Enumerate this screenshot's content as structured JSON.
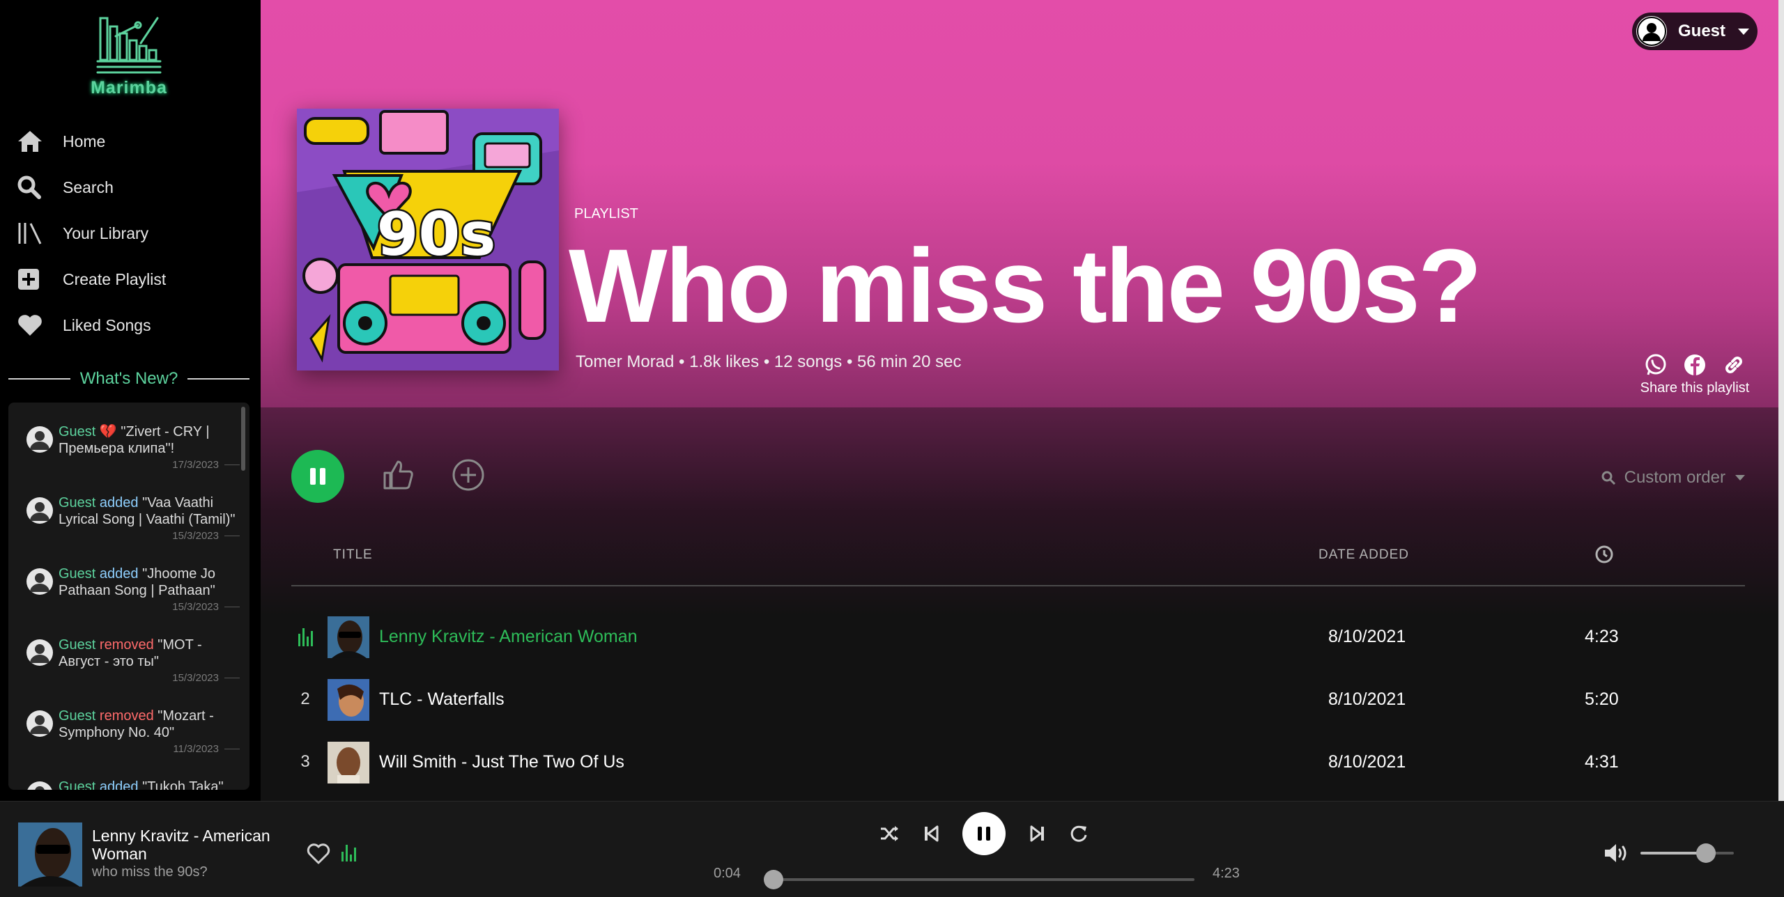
{
  "app": {
    "name": "Marimba"
  },
  "nav": {
    "items": [
      {
        "label": "Home",
        "icon": "home-icon"
      },
      {
        "label": "Search",
        "icon": "search-icon"
      },
      {
        "label": "Your Library",
        "icon": "library-icon"
      },
      {
        "label": "Create Playlist",
        "icon": "plus-square-icon"
      },
      {
        "label": "Liked Songs",
        "icon": "heart-icon"
      }
    ]
  },
  "whats_new": {
    "title": "What's New?",
    "items": [
      {
        "user": "Guest",
        "action": "",
        "emoji": "💔",
        "text": "\"Zivert - CRY | Премьера клипа\"!",
        "date": "17/3/2023"
      },
      {
        "user": "Guest",
        "action": "added",
        "text": "\"Vaa Vaathi Lyrical Song | Vaathi (Tamil)\"",
        "date": "15/3/2023"
      },
      {
        "user": "Guest",
        "action": "added",
        "text": "\"Jhoome Jo Pathaan Song | Pathaan\"",
        "date": "15/3/2023"
      },
      {
        "user": "Guest",
        "action": "removed",
        "text": "\"MOT - Август - это ты\"",
        "date": "15/3/2023"
      },
      {
        "user": "Guest",
        "action": "removed",
        "text": "\"Mozart - Symphony No. 40\"",
        "date": "11/3/2023"
      },
      {
        "user": "Guest",
        "action": "added",
        "text": "\"Tukoh Taka\"",
        "date": ""
      }
    ]
  },
  "user": {
    "name": "Guest"
  },
  "playlist": {
    "type_label": "PLAYLIST",
    "title": "Who miss the 90s?",
    "meta": "Tomer Morad • 1.8k likes • 12 songs • 56 min 20 sec",
    "share_label": "Share this playlist",
    "sort_label": "Custom order"
  },
  "table": {
    "headers": {
      "title": "TITLE",
      "date": "DATE ADDED"
    },
    "rows": [
      {
        "num": "1",
        "title": "Lenny Kravitz - American Woman",
        "date": "8/10/2021",
        "duration": "4:23",
        "active": true
      },
      {
        "num": "2",
        "title": "TLC - Waterfalls",
        "date": "8/10/2021",
        "duration": "5:20",
        "active": false
      },
      {
        "num": "3",
        "title": "Will Smith - Just The Two Of Us",
        "date": "8/10/2021",
        "duration": "4:31",
        "active": false
      }
    ]
  },
  "player": {
    "now_playing_title": "Lenny Kravitz - American Woman",
    "now_playing_playlist": "who miss the 90s?",
    "elapsed": "0:04",
    "total": "4:23",
    "progress_fraction": 0.016,
    "volume_fraction": 0.7
  },
  "colors": {
    "accent": "#1db954",
    "brand": "#5dd39e",
    "hero": "#e34da9",
    "added": "#8fd0ff",
    "removed": "#ff6b6b"
  }
}
